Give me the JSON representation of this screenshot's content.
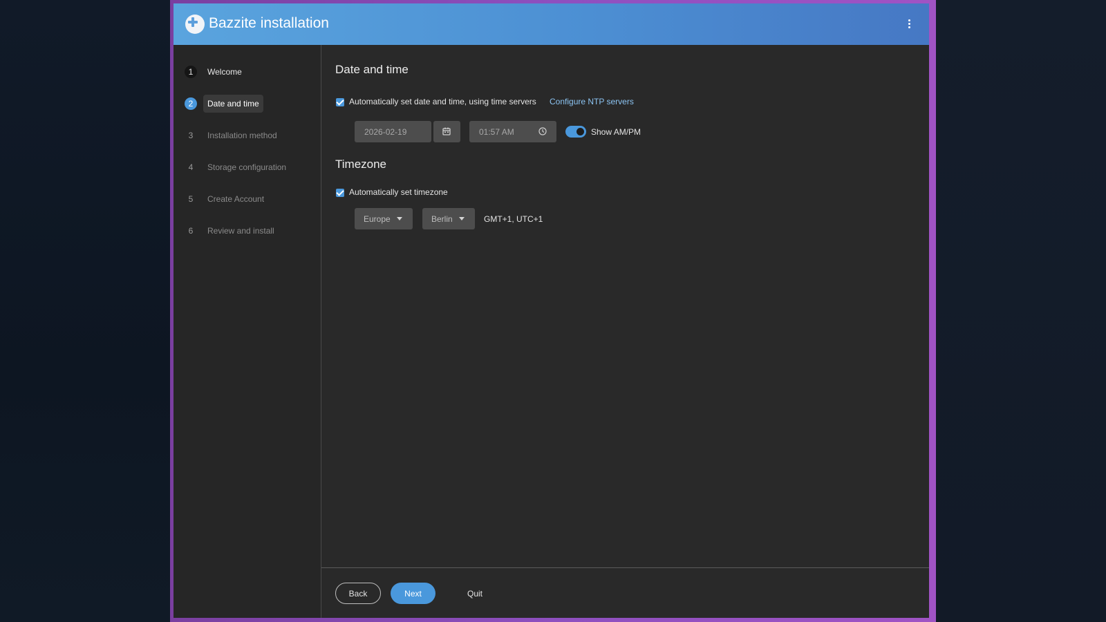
{
  "app": {
    "title": "Bazzite installation"
  },
  "steps": [
    {
      "num": "1",
      "label": "Welcome",
      "state": "done"
    },
    {
      "num": "2",
      "label": "Date and time",
      "state": "current"
    },
    {
      "num": "3",
      "label": "Installation method",
      "state": "pending"
    },
    {
      "num": "4",
      "label": "Storage configuration",
      "state": "pending"
    },
    {
      "num": "5",
      "label": "Create Account",
      "state": "pending"
    },
    {
      "num": "6",
      "label": "Review and install",
      "state": "pending"
    }
  ],
  "datetime": {
    "heading": "Date and time",
    "auto_label": "Automatically set date and time, using time servers",
    "auto_checked": true,
    "ntp_link": "Configure NTP servers",
    "date_value": "2026-02-19",
    "time_value": "01:57 AM",
    "ampm_label": "Show AM/PM",
    "ampm_on": true
  },
  "timezone": {
    "heading": "Timezone",
    "auto_label": "Automatically set timezone",
    "auto_checked": true,
    "region": "Europe",
    "city": "Berlin",
    "offset": "GMT+1, UTC+1"
  },
  "footer": {
    "back": "Back",
    "next": "Next",
    "quit": "Quit"
  },
  "colors": {
    "accent": "#4a98dc",
    "header_start": "#5aa4de",
    "header_end": "#4678c4"
  }
}
